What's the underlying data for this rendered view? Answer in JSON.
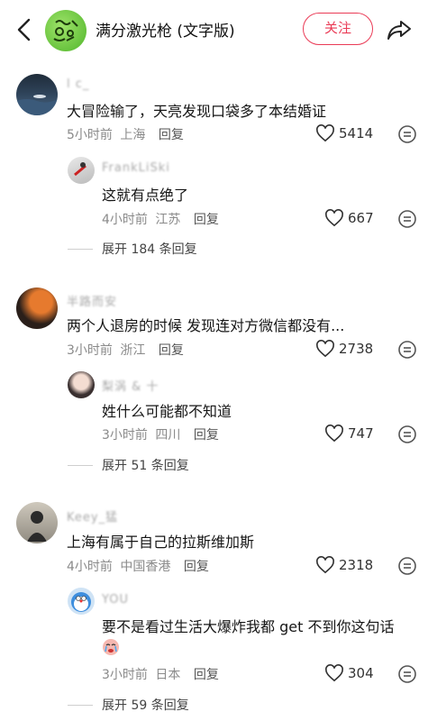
{
  "header": {
    "title": "满分激光枪 (文字版)",
    "follow_label": "关注",
    "icons": [
      "back-icon",
      "share-icon"
    ]
  },
  "comments": [
    {
      "user": "l c_",
      "text": "大冒险输了，天亮发现口袋多了本结婚证",
      "time": "5小时前",
      "location": "上海",
      "reply": "回复",
      "likes": "5414",
      "sub": {
        "user": "FrankLiSki",
        "text": "这就有点绝了",
        "time": "4小时前",
        "location": "江苏",
        "reply": "回复",
        "likes": "667"
      },
      "expand": "展开 184 条回复"
    },
    {
      "user": "半路而安",
      "text": "两个人退房的时候 发现连对方微信都没有...",
      "time": "3小时前",
      "location": "浙江",
      "reply": "回复",
      "likes": "2738",
      "sub": {
        "user": "梨涡 & 十",
        "text": "姓什么可能都不知道",
        "time": "3小时前",
        "location": "四川",
        "reply": "回复",
        "likes": "747"
      },
      "expand": "展开 51 条回复"
    },
    {
      "user": "Keey_猛",
      "text": "上海有属于自己的拉斯维加斯",
      "time": "4小时前",
      "location": "中国香港",
      "reply": "回复",
      "likes": "2318",
      "sub": {
        "user": "YOU",
        "text": "要不是看过生活大爆炸我都 get 不到你这句话",
        "time": "3小时前",
        "location": "日本",
        "reply": "回复",
        "likes": "304"
      },
      "expand": "展开 59 条回复"
    }
  ],
  "colors": {
    "accent": "#ea3b56",
    "meta": "#8a8a8a"
  }
}
